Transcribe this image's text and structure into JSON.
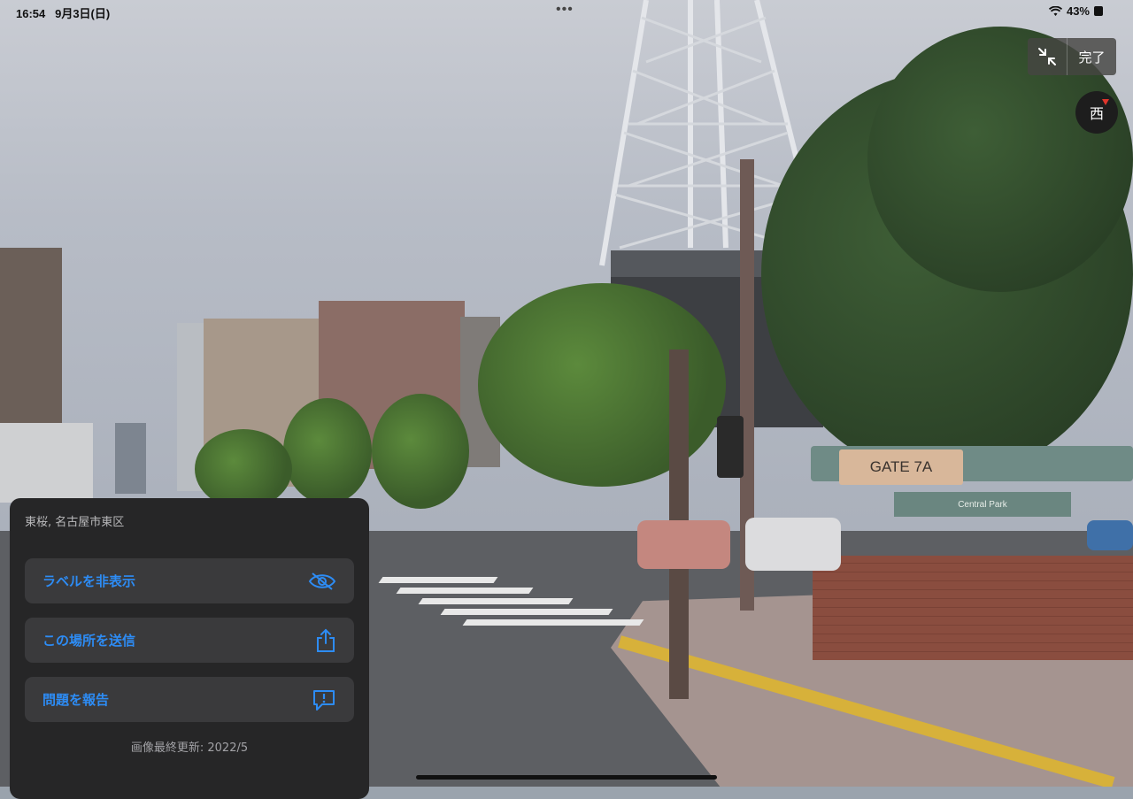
{
  "status_bar": {
    "time": "16:54",
    "date": "9月3日(日)",
    "battery_percent": "43%",
    "more_dots": "•••"
  },
  "controls": {
    "done_label": "完了",
    "compass_direction": "西",
    "collapse_icon": "collapse-arrows-icon"
  },
  "panel": {
    "location": "東桜, 名古屋市東区",
    "buttons": [
      {
        "label": "ラベルを非表示",
        "icon": "eye-slash-icon"
      },
      {
        "label": "この場所を送信",
        "icon": "share-icon"
      },
      {
        "label": "問題を報告",
        "icon": "report-exclamation-icon"
      }
    ],
    "image_updated": "画像最終更新: 2022/5"
  },
  "scene": {
    "gate_sign": "GATE 7A",
    "gate_subsign": "Central Park",
    "accent_color": "#2d8cf5"
  }
}
